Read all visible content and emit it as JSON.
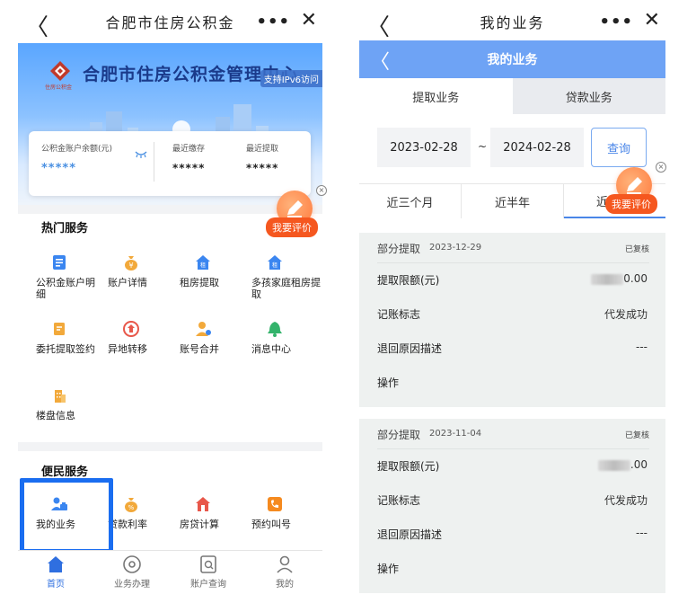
{
  "left": {
    "topbar": {
      "back": "〈",
      "title": "合肥市住房公积金",
      "more": "•••",
      "close": "✕"
    },
    "banner": {
      "logo_sub": "住房公积金",
      "title": "合肥市住房公积金管理中心",
      "ipv6": "支持IPv6访问"
    },
    "account": {
      "balance_label": "公积金账户余额(元)",
      "balance_value": "*****",
      "deposit_label": "最近缴存",
      "deposit_value": "*****",
      "withdraw_label": "最近提取",
      "withdraw_value": "*****"
    },
    "hot_services": {
      "title": "热门服务",
      "items": [
        {
          "label": "公积金账户明细",
          "icon": "document-icon"
        },
        {
          "label": "账户详情",
          "icon": "money-bag-icon"
        },
        {
          "label": "租房提取",
          "icon": "house-rent-icon"
        },
        {
          "label": "多孩家庭租房提取",
          "icon": "house-rent-icon"
        },
        {
          "label": "委托提取签约",
          "icon": "contract-icon"
        },
        {
          "label": "异地转移",
          "icon": "transfer-icon"
        },
        {
          "label": "账号合并",
          "icon": "user-merge-icon"
        },
        {
          "label": "消息中心",
          "icon": "bell-icon"
        },
        {
          "label": "楼盘信息",
          "icon": "building-icon"
        }
      ]
    },
    "convenience": {
      "title": "便民服务",
      "items": [
        {
          "label": "我的业务",
          "icon": "user-business-icon"
        },
        {
          "label": "贷款利率",
          "icon": "percent-bag-icon"
        },
        {
          "label": "房贷计算",
          "icon": "house-calc-icon"
        },
        {
          "label": "预约叫号",
          "icon": "phone-icon"
        }
      ]
    },
    "eval": {
      "label": "我要评价",
      "close": "×"
    },
    "tabs": [
      {
        "label": "首页",
        "icon": "home-icon"
      },
      {
        "label": "业务办理",
        "icon": "circle-icon"
      },
      {
        "label": "账户查询",
        "icon": "search-doc-icon"
      },
      {
        "label": "我的",
        "icon": "person-icon"
      }
    ]
  },
  "right": {
    "topbar": {
      "back": "〈",
      "title": "我的业务",
      "more": "•••",
      "close": "✕"
    },
    "header": {
      "back": "〈",
      "title": "我的业务"
    },
    "segments": [
      "提取业务",
      "贷款业务"
    ],
    "date_from": "2023-02-28",
    "date_sep": "~",
    "date_to": "2024-02-28",
    "query_label": "查询",
    "ranges": [
      "近三个月",
      "近半年",
      "近"
    ],
    "eval": {
      "label": "我要评价",
      "close": "×"
    },
    "records": [
      {
        "type": "部分提取",
        "date": "2023-12-29",
        "status": "已复核",
        "limit_label": "提取限额(元)",
        "limit_suffix": "0.00",
        "flag_label": "记账标志",
        "flag_value": "代发成功",
        "reason_label": "退回原因描述",
        "reason_value": "---",
        "op_label": "操作"
      },
      {
        "type": "部分提取",
        "date": "2023-11-04",
        "status": "已复核",
        "limit_label": "提取限额(元)",
        "limit_suffix": ".00",
        "flag_label": "记账标志",
        "flag_value": "代发成功",
        "reason_label": "退回原因描述",
        "reason_value": "---",
        "op_label": "操作"
      }
    ]
  },
  "colors": {
    "accent": "#4a86e8",
    "header_blue": "#6ea3f5",
    "highlight": "#1a6df0",
    "eval_orange": "#f5571f"
  }
}
